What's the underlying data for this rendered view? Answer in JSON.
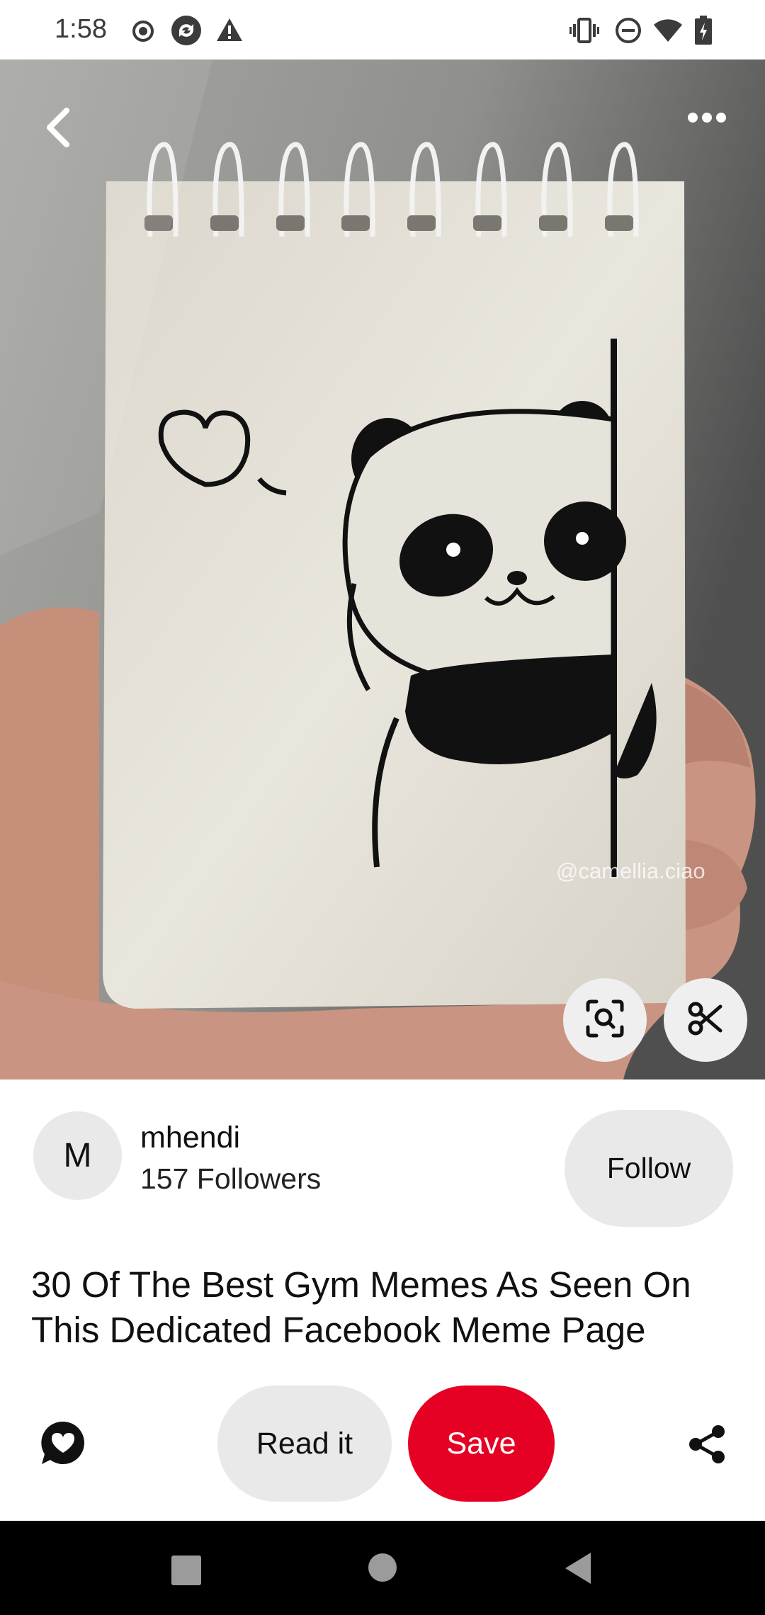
{
  "status_bar": {
    "time": "1:58",
    "left_icons": [
      "record-icon",
      "sync-icon",
      "warning-icon"
    ],
    "right_icons": [
      "vibrate-icon",
      "do-not-disturb-icon",
      "wifi-icon",
      "battery-icon"
    ]
  },
  "pin": {
    "image_description_icon": "panda-notebook-photo",
    "watermark": "@camellia.ciao",
    "back_icon": "back-arrow-icon",
    "more_icon": "more-options-icon",
    "visual_search_icon": "visual-search-icon",
    "cut_icon": "scissors-icon"
  },
  "creator": {
    "avatar_letter": "M",
    "name": "mhendi",
    "followers": "157 Followers",
    "follow_label": "Follow"
  },
  "title": "30 Of The Best Gym Memes As Seen On This Dedicated Facebook Meme Page",
  "actions": {
    "comment_icon": "comment-heart-icon",
    "read_label": "Read it",
    "save_label": "Save",
    "share_icon": "share-icon"
  },
  "nav": {
    "icons": [
      "recents-square-icon",
      "home-circle-icon",
      "back-triangle-icon"
    ]
  },
  "colors": {
    "save": "#e60023",
    "pill": "#e9e9e9",
    "nav_bg": "#000000"
  }
}
